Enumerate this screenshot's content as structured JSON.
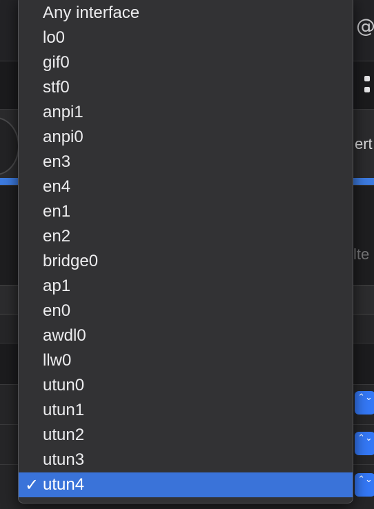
{
  "interface_menu": {
    "items": [
      {
        "label": "Any interface",
        "checked": false
      },
      {
        "label": "lo0",
        "checked": false
      },
      {
        "label": "gif0",
        "checked": false
      },
      {
        "label": "stf0",
        "checked": false
      },
      {
        "label": "anpi1",
        "checked": false
      },
      {
        "label": "anpi0",
        "checked": false
      },
      {
        "label": "en3",
        "checked": false
      },
      {
        "label": "en4",
        "checked": false
      },
      {
        "label": "en1",
        "checked": false
      },
      {
        "label": "en2",
        "checked": false
      },
      {
        "label": "bridge0",
        "checked": false
      },
      {
        "label": "ap1",
        "checked": false
      },
      {
        "label": "en0",
        "checked": false
      },
      {
        "label": "awdl0",
        "checked": false
      },
      {
        "label": "llw0",
        "checked": false
      },
      {
        "label": "utun0",
        "checked": false
      },
      {
        "label": "utun1",
        "checked": false
      },
      {
        "label": "utun2",
        "checked": false
      },
      {
        "label": "utun3",
        "checked": false
      },
      {
        "label": "utun4",
        "checked": true
      }
    ],
    "check_glyph": "✓"
  },
  "background": {
    "partial_label_top": "ert",
    "partial_label_filter": "lte",
    "stepper_glyph": "⌃⌄"
  },
  "colors": {
    "menu_background": "#323234",
    "selection_highlight": "#3a73d9",
    "accent": "#3478f6",
    "menu_text": "#ececee"
  }
}
